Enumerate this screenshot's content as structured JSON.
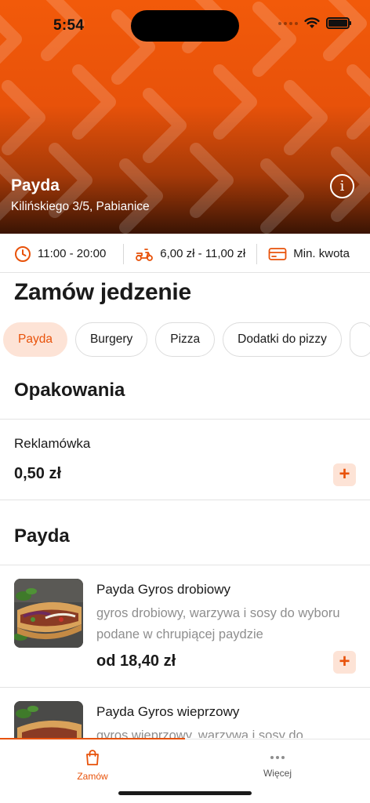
{
  "status_bar": {
    "time": "5:54"
  },
  "restaurant": {
    "name": "Payda",
    "address": "Kilińskiego 3/5, Pabianice"
  },
  "info_strip": {
    "hours": "11:00 - 20:00",
    "delivery_cost": "6,00 zł - 11,00 zł",
    "min_order": "Min. kwota"
  },
  "page_title": "Zamów jedzenie",
  "categories": [
    {
      "label": "Payda",
      "active": true
    },
    {
      "label": "Burgery",
      "active": false
    },
    {
      "label": "Pizza",
      "active": false
    },
    {
      "label": "Dodatki do pizzy",
      "active": false
    }
  ],
  "sections": [
    {
      "title": "Opakowania",
      "items": [
        {
          "name": "Reklamówka",
          "price": "0,50 zł"
        }
      ]
    },
    {
      "title": "Payda",
      "items": [
        {
          "name": "Payda Gyros drobiowy",
          "description": "gyros drobiowy, warzywa i sosy do wyboru podane w chrupiącej paydzie",
          "price": "od 18,40 zł"
        },
        {
          "name": "Payda Gyros wieprzowy",
          "description": "gyros wieprzowy, warzywa i sosy do"
        }
      ]
    }
  ],
  "add_label": "+",
  "tabbar": {
    "orders": "Zamów",
    "more": "Więcej"
  },
  "colors": {
    "accent": "#e8520a",
    "accent_light": "#fde3d6"
  },
  "icons": [
    "clock-icon",
    "scooter-icon",
    "card-icon",
    "info-icon",
    "bag-icon",
    "more-dots-icon",
    "wifi-icon",
    "battery-icon"
  ]
}
